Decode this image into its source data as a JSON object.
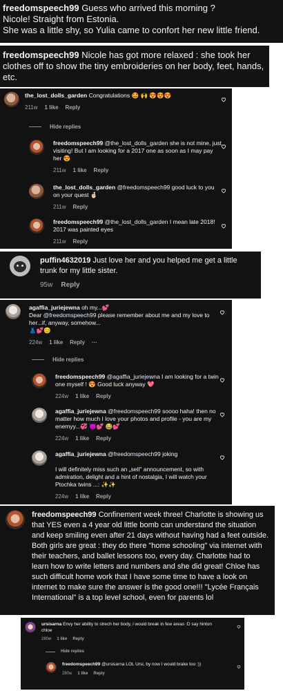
{
  "captions": [
    {
      "user": "freedomspeech99",
      "text": "Guess who arrived this morning ?",
      "lines": [
        "Nicole! Straight from Estonia.",
        "She was a little shy, so Yulia came to confort her new little friend."
      ]
    },
    {
      "user": "freedomspeech99",
      "text": "Nicole has got more relaxed : she took her clothes off to show the tiny embroideries on her body, feet, hands, etc."
    }
  ],
  "thread1": {
    "top": {
      "user": "the_lost_dolls_garden",
      "text": "Congratulations 🤩 🙌 😍😍😍",
      "time": "211w",
      "likes": "1 like",
      "reply": "Reply"
    },
    "hide_replies": "Hide replies",
    "replies": [
      {
        "user": "freedomspeech99",
        "mention": "@the_lost_dolls_garden",
        "text": " she is not mine, just visiting! But I am looking for a 2017 one as soon as I may pay her 😍",
        "time": "211w",
        "likes": "1 like",
        "reply": "Reply"
      },
      {
        "user": "the_lost_dolls_garden",
        "mention": "@freedomspeech99",
        "text": " good luck to you on your quest 🤞🏻",
        "time": "211w",
        "reply": "Reply"
      },
      {
        "user": "freedomspeech99",
        "mention": "@the_lost_dolls_garden",
        "text": " I mean late 2018! 2017 was painted eyes",
        "time": "211w",
        "reply": "Reply"
      }
    ]
  },
  "puffin": {
    "user": "puffin4632019",
    "text": "Just love her and you helped me get a little trunk for my little sister.",
    "time": "95w",
    "reply": "Reply"
  },
  "thread2": {
    "top": {
      "user": "agaffia_juriejewna",
      "text_pre": "oh my...💕",
      "line2_pre": "Dear ",
      "mention": "@freedomspeech99",
      "text": " please remember about me and my love to her...if, anyway, somehow...",
      "emoji_line": "👗💕😊",
      "time": "224w",
      "likes": "1 like",
      "reply": "Reply",
      "more": "···"
    },
    "hide_replies": "Hide replies",
    "replies": [
      {
        "user": "freedomspeech99",
        "mention": "@agaffia_juriejewna",
        "text": " I am looking for a twin one myself ! 😍 Good luck anyway 💖",
        "time": "224w",
        "likes": "1 like",
        "reply": "Reply"
      },
      {
        "user": "agaffia_juriejewna",
        "mention": "@freedomspeech99",
        "text": " soooo haha! then no matter how much I love your photos and profile - you are my enemyy...💞 👿💕 😂💕",
        "time": "224w",
        "likes": "1 like",
        "reply": "Reply"
      },
      {
        "user": "agaffia_juriejewna",
        "mention": "@freedomspeech99",
        "text": " joking",
        "para": "I will definitely miss such an „sell\" announcement, so with admiration, delight and a hint of nostalgia, I will watch your Ptochka twins ...: ✨✨",
        "time": "224w",
        "likes": "1 like",
        "reply": "Reply"
      }
    ]
  },
  "confinement": {
    "user": "freedomspeech99",
    "text": "Confinement week three! Charlotte is showing us that YES even a 4 year old little bomb can understand the situation and keep smiling even after 21 days without having had a feet outside. Both girls are great : they do there \"home schooling\" via internet with their teachers, and ballet lessons too, every day. Charlotte had to learn how to write letters and numbers and she did great! Chloe has such difficult home work that I have some time to have a look on internet to make sure the answer is the good one!!! \"Lycée Français International\" is a top level school, even for parents lol"
  },
  "thread3": {
    "top": {
      "user": "ursisarna",
      "text": "Envy her ability to strech her body, i would break in few areas :D say hinton chloe",
      "time": "280w",
      "likes": "1 like",
      "reply": "Reply"
    },
    "hide_replies": "Hide replies",
    "reply": {
      "user": "freedomspeech99",
      "mention": "@ursisarna",
      "text": " LOL Ursi, by now I would brake too :))",
      "time": "280w",
      "likes": "1 like",
      "reply": "Reply"
    }
  },
  "colors": {
    "bg": "#121212",
    "text": "#f5f5f5",
    "muted": "#a8a8a8",
    "mention": "#e0f1ff",
    "page": "#ffffff"
  },
  "icons": [
    "heart-icon",
    "avatar-doll",
    "avatar-cat"
  ]
}
